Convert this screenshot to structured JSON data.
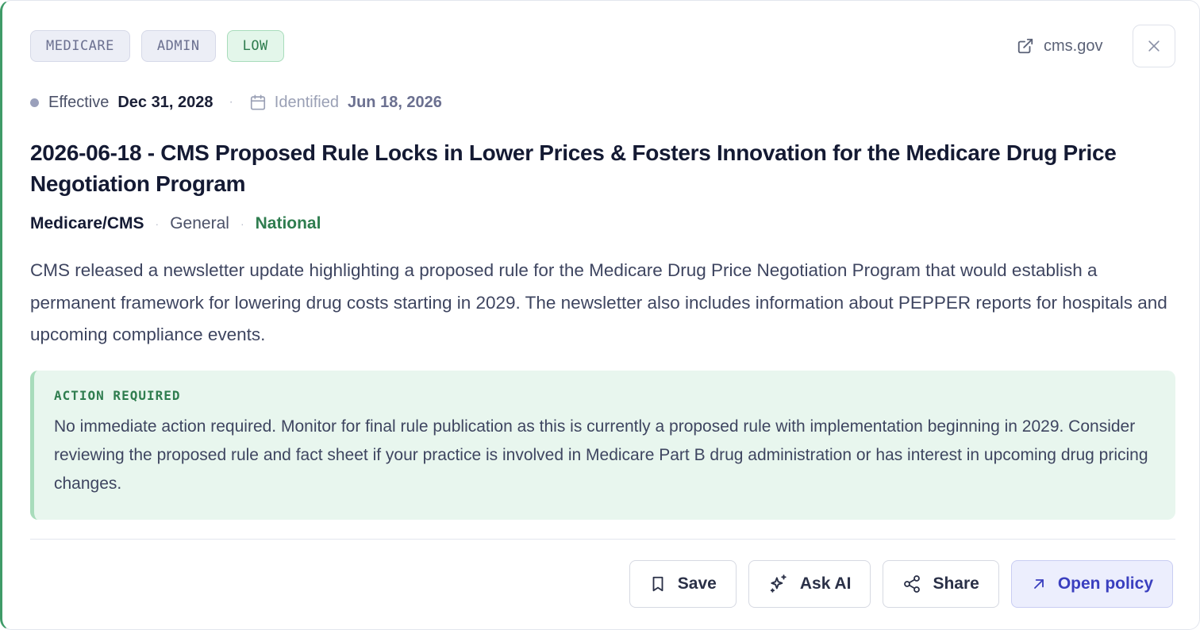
{
  "tags": [
    {
      "label": "MEDICARE"
    },
    {
      "label": "ADMIN"
    },
    {
      "label": "LOW"
    }
  ],
  "source": {
    "label": "cms.gov",
    "icon": "external-link-icon"
  },
  "close": {
    "icon": "close-icon"
  },
  "meta": {
    "effective_label": "Effective",
    "effective_date": "Dec 31, 2028",
    "separator": "·",
    "identified_label": "Identified",
    "identified_date": "Jun 18, 2026"
  },
  "title": "2026-06-18 - CMS Proposed Rule Locks in Lower Prices & Fosters Innovation for the Medicare Drug Price Negotiation Program",
  "subline": {
    "agency": "Medicare/CMS",
    "category": "General",
    "scope": "National",
    "separator": "·"
  },
  "summary": "CMS released a newsletter update highlighting a proposed rule for the Medicare Drug Price Negotiation Program that would establish a permanent framework for lowering drug costs starting in 2029. The newsletter also includes information about PEPPER reports for hospitals and upcoming compliance events.",
  "action": {
    "heading": "ACTION REQUIRED",
    "text": "No immediate action required. Monitor for final rule publication as this is currently a proposed rule with implementation beginning in 2029. Consider reviewing the proposed rule and fact sheet if your practice is involved in Medicare Part B drug administration or has interest in upcoming drug pricing changes."
  },
  "buttons": {
    "save": {
      "label": "Save",
      "icon": "bookmark-icon"
    },
    "ask_ai": {
      "label": "Ask AI",
      "icon": "sparkles-icon"
    },
    "share": {
      "label": "Share",
      "icon": "share-icon"
    },
    "open": {
      "label": "Open policy",
      "icon": "arrow-up-right-icon"
    }
  },
  "colors": {
    "accent_green": "#3f9b68",
    "low_badge": "#2f7d4f",
    "primary_button": "#3a3fbf"
  }
}
